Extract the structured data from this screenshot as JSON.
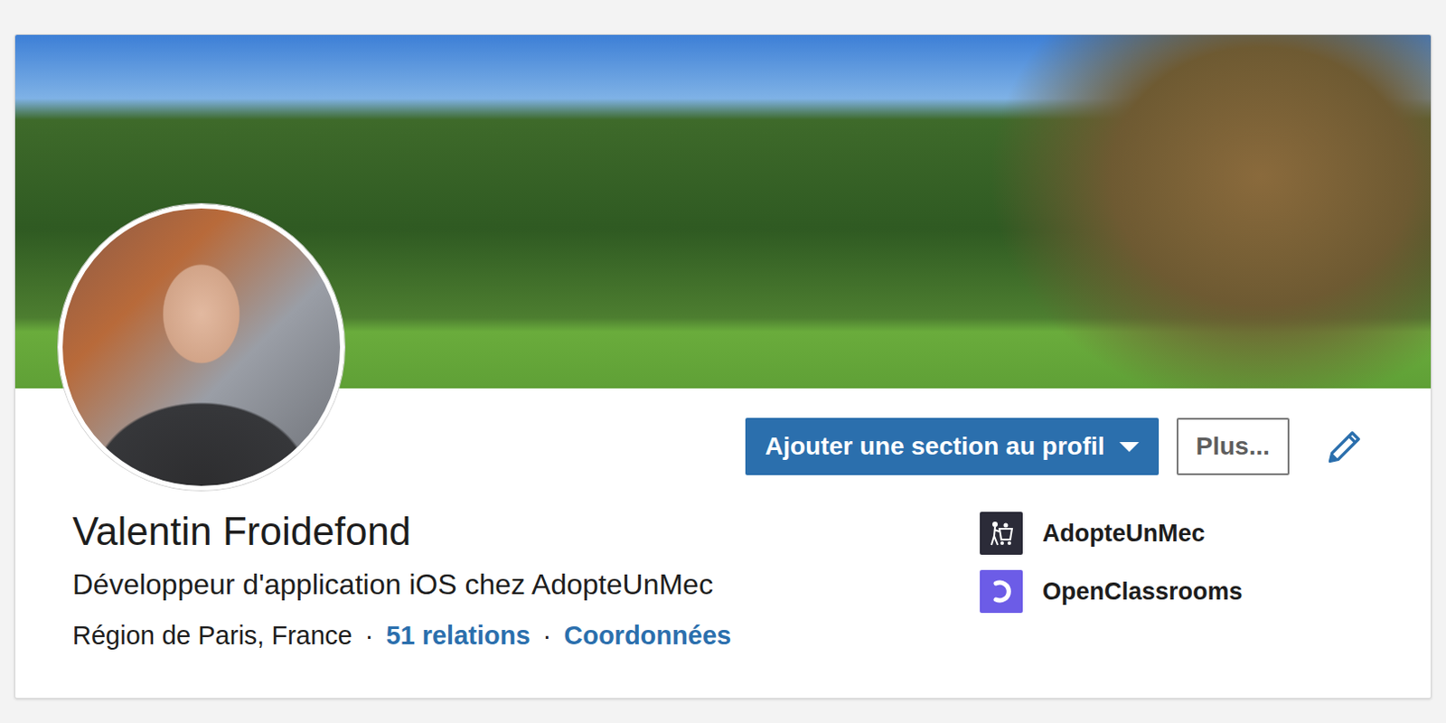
{
  "profile": {
    "name": "Valentin Froidefond",
    "headline": "Développeur d'application iOS chez AdopteUnMec",
    "separator": "·",
    "meta": [
      {
        "text": "Région de Paris, France",
        "kind": "plain"
      },
      {
        "text": "51 relations",
        "kind": "link"
      },
      {
        "text": "Coordonnées",
        "kind": "link"
      }
    ]
  },
  "actions": {
    "add_section": "Ajouter une section au profil",
    "more": "Plus..."
  },
  "companies": [
    {
      "name": "AdopteUnMec",
      "kind": "cart",
      "color": "#2b2b38"
    },
    {
      "name": "OpenClassrooms",
      "kind": "crescent",
      "color": "#6c5ce7"
    }
  ]
}
